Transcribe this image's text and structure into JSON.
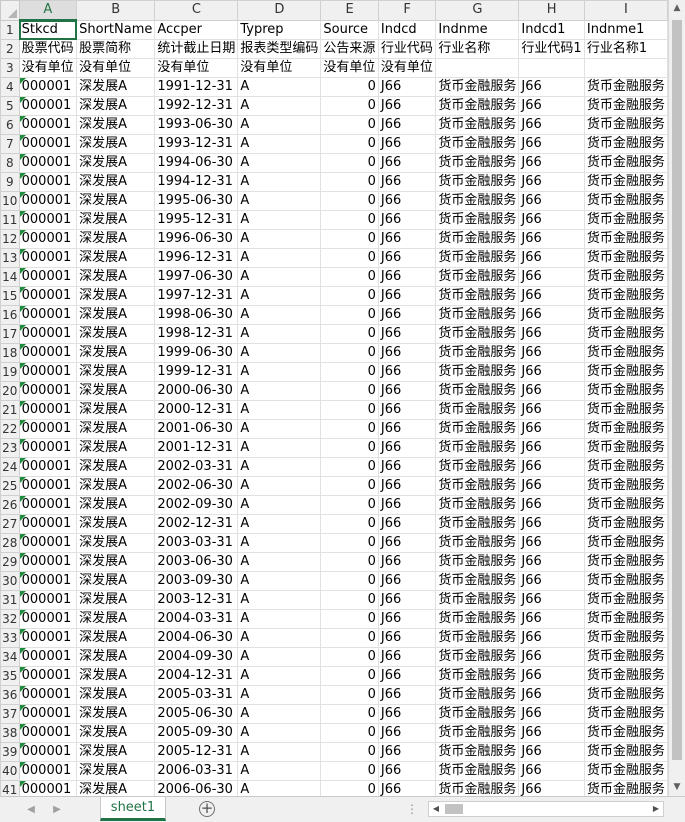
{
  "spreadsheet": {
    "column_letters": [
      "A",
      "B",
      "C",
      "D",
      "E",
      "F",
      "G",
      "H",
      "I"
    ],
    "active_column": "A",
    "header_row": [
      "Stkcd",
      "ShortName",
      "Accper",
      "Typrep",
      "Source",
      "Indcd",
      "Indnme",
      "Indcd1",
      "Indnme1"
    ],
    "desc_row": [
      "股票代码",
      "股票简称",
      "统计截止日期",
      "报表类型编码",
      "公告来源",
      "行业代码",
      "行业名称",
      "行业代码1",
      "行业名称1"
    ],
    "unit_row": [
      "没有单位",
      "没有单位",
      "没有单位",
      "没有单位",
      "没有单位",
      "没有单位",
      "",
      "",
      ""
    ],
    "stock_code": "000001",
    "short_name": "深发展A",
    "typrep": "A",
    "source": "0",
    "indcd": "J66",
    "indnme": "货币金融服务",
    "indcd1": "J66",
    "indnme1": "货币金融服务",
    "dates": [
      "1991-12-31",
      "1992-12-31",
      "1993-06-30",
      "1993-12-31",
      "1994-06-30",
      "1994-12-31",
      "1995-06-30",
      "1995-12-31",
      "1996-06-30",
      "1996-12-31",
      "1997-06-30",
      "1997-12-31",
      "1998-06-30",
      "1998-12-31",
      "1999-06-30",
      "1999-12-31",
      "2000-06-30",
      "2000-12-31",
      "2001-06-30",
      "2001-12-31",
      "2002-03-31",
      "2002-06-30",
      "2002-09-30",
      "2002-12-31",
      "2003-03-31",
      "2003-06-30",
      "2003-09-30",
      "2003-12-31",
      "2004-03-31",
      "2004-06-30",
      "2004-09-30",
      "2004-12-31",
      "2005-03-31",
      "2005-06-30",
      "2005-09-30",
      "2005-12-31",
      "2006-03-31",
      "2006-06-30"
    ]
  },
  "tabs": {
    "nav_prev": "◀",
    "nav_next": "▶",
    "sheet_name": "sheet1",
    "add_symbol": "+",
    "dots": "⋮"
  },
  "scroll": {
    "up": "▲",
    "down": "▼",
    "left": "◀",
    "right": "▶"
  },
  "colors": {
    "accent": "#217346",
    "error_triangle": "#1e8e3e"
  }
}
